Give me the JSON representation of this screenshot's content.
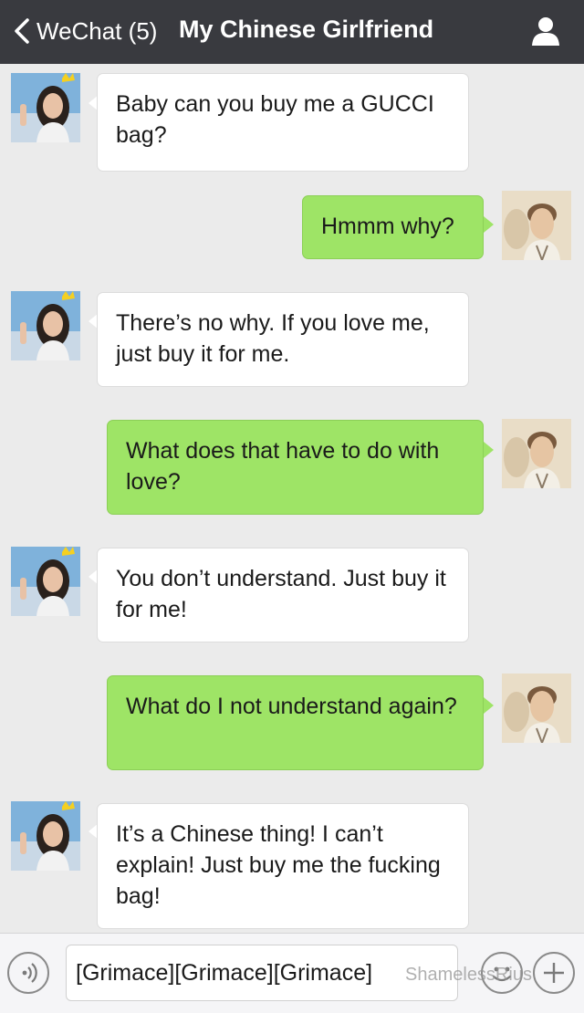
{
  "nav": {
    "back_label": "WeChat (5)",
    "title": "My Chinese Girlfriend",
    "icons": {
      "back": "chevron-left-icon",
      "profile": "person-icon"
    }
  },
  "messages": [
    {
      "from": "girlfriend",
      "text": "Baby can you buy me a GUCCI bag?"
    },
    {
      "from": "me",
      "text": "Hmmm why?"
    },
    {
      "from": "girlfriend",
      "text": "There’s no why. If you love me, just buy it for me."
    },
    {
      "from": "me",
      "text": "What does that have to do with love?"
    },
    {
      "from": "girlfriend",
      "text": "You don’t understand. Just buy it for me!"
    },
    {
      "from": "me",
      "text": "What do I not understand again?"
    },
    {
      "from": "girlfriend",
      "text": "It’s a Chinese thing! I can’t explain! Just buy me the fucking bag!"
    }
  ],
  "input": {
    "value": "[Grimace][Grimace][Grimace]",
    "icons": {
      "voice": "voice-icon",
      "emoji": "emoji-icon",
      "plus": "plus-icon"
    }
  },
  "watermark": "ShamelessRius",
  "colors": {
    "nav_bg": "#393a3f",
    "chat_bg": "#ebebeb",
    "bubble_in": "#ffffff",
    "bubble_out": "#9ee466"
  }
}
